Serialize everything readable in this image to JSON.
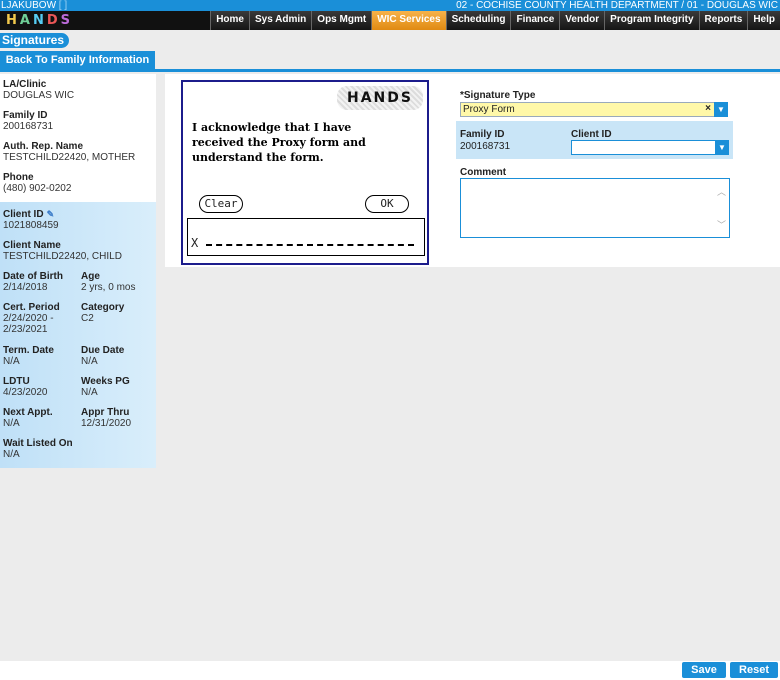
{
  "topbar": {
    "user": "LJAKUBOW",
    "user_link": "[      ]",
    "agency": "02 - COCHISE COUNTY HEALTH DEPARTMENT / 01 - DOUGLAS WIC"
  },
  "logo_text": "HANDS",
  "nav": [
    "Home",
    "Sys Admin",
    "Ops Mgmt",
    "WIC Services",
    "Scheduling",
    "Finance",
    "Vendor",
    "Program Integrity",
    "Reports",
    "Help"
  ],
  "active_nav": "WIC Services",
  "page_title": "Signatures",
  "back_button": "Back To Family Information",
  "left": {
    "la_clinic": {
      "label": "LA/Clinic",
      "value": "DOUGLAS WIC"
    },
    "family_id": {
      "label": "Family ID",
      "value": "200168731"
    },
    "auth_rep": {
      "label": "Auth. Rep. Name",
      "value": "TESTCHILD22420, MOTHER"
    },
    "phone": {
      "label": "Phone",
      "value": "(480) 902-0202"
    },
    "client_id": {
      "label": "Client ID",
      "value": "1021808459"
    },
    "client_name": {
      "label": "Client Name",
      "value": "TESTCHILD22420, CHILD"
    },
    "dob": {
      "label": "Date of Birth",
      "value": "2/14/2018"
    },
    "age": {
      "label": "Age",
      "value": "2 yrs, 0 mos"
    },
    "cert_period": {
      "label": "Cert. Period",
      "value1": "2/24/2020 -",
      "value2": "2/23/2021"
    },
    "category": {
      "label": "Category",
      "value": "C2"
    },
    "term_date": {
      "label": "Term. Date",
      "value": "N/A"
    },
    "due_date": {
      "label": "Due Date",
      "value": "N/A"
    },
    "ldtu": {
      "label": "LDTU",
      "value": "4/23/2020"
    },
    "weeks_pg": {
      "label": "Weeks PG",
      "value": "N/A"
    },
    "next_appt": {
      "label": "Next Appt.",
      "value": "N/A"
    },
    "appr_thru": {
      "label": "Appr Thru",
      "value": "12/31/2020"
    },
    "wait_listed": {
      "label": "Wait Listed On",
      "value": "N/A"
    }
  },
  "signature_pad": {
    "logo": "HANDS",
    "text": "I acknowledge that I have received the Proxy form and understand the form.",
    "clear_label": "Clear",
    "ok_label": "OK",
    "x_mark": "X"
  },
  "form": {
    "signature_type_label": "*Signature Type",
    "signature_type_value": "Proxy Form",
    "family_id_label": "Family ID",
    "family_id_value": "200168731",
    "client_id_label": "Client ID",
    "client_id_value": "",
    "comment_label": "Comment",
    "comment_value": ""
  },
  "buttons": {
    "save": "Save",
    "reset": "Reset"
  }
}
